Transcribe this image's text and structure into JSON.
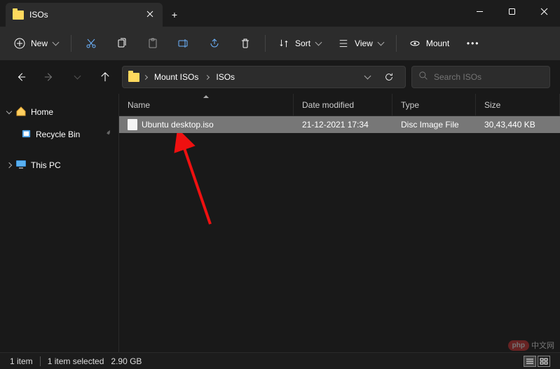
{
  "window": {
    "title": "ISOs"
  },
  "toolbar": {
    "new_label": "New",
    "sort_label": "Sort",
    "view_label": "View",
    "mount_label": "Mount"
  },
  "breadcrumb": {
    "items": [
      "Mount ISOs",
      "ISOs"
    ]
  },
  "search": {
    "placeholder": "Search ISOs"
  },
  "sidebar": {
    "home": "Home",
    "recycle": "Recycle Bin",
    "thispc": "This PC"
  },
  "columns": {
    "name": "Name",
    "date": "Date modified",
    "type": "Type",
    "size": "Size"
  },
  "files": [
    {
      "name": "Ubuntu desktop.iso",
      "date": "21-12-2021 17:34",
      "type": "Disc Image File",
      "size": "30,43,440 KB"
    }
  ],
  "status": {
    "count": "1 item",
    "selected": "1 item selected",
    "size": "2.90 GB"
  },
  "watermark": "中文网"
}
